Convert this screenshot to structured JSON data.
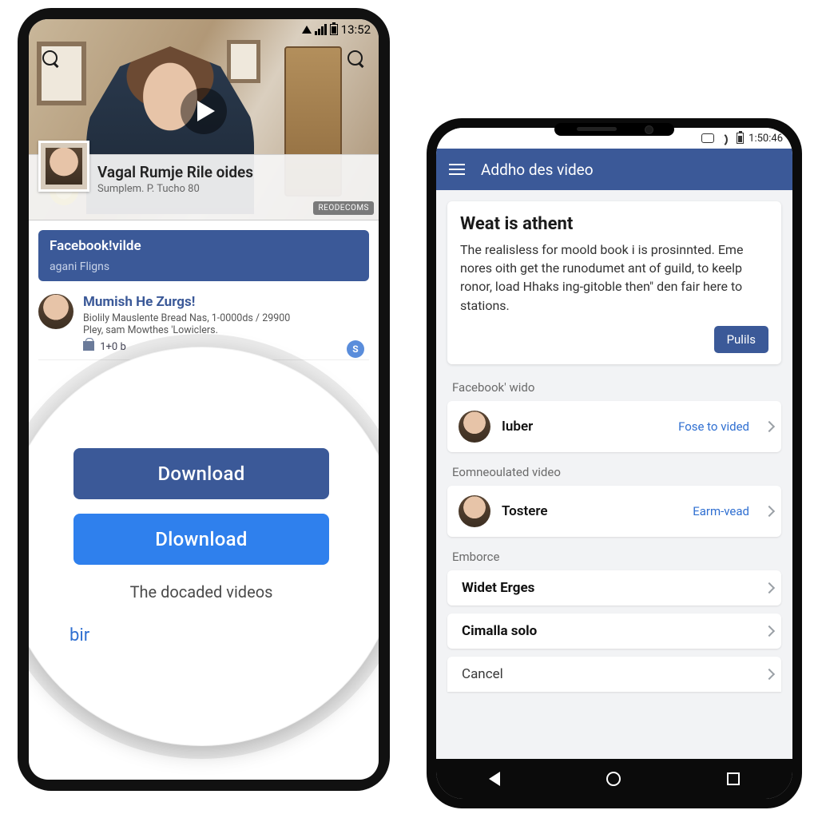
{
  "left": {
    "status_time": "13:52",
    "hero": {
      "title": "Vagal Rumje Rile oides",
      "subtitle": "Sumplem. P. Tucho 80",
      "badge": "REODECOMS"
    },
    "banner": {
      "title": "Facebook!vilde",
      "subtitle": "agani Fligns"
    },
    "post": {
      "title": "Mumish He Zurgs!",
      "line1": "Biolily Mauslente  Bread  Nas, 1-0000ds / 29900",
      "line2": "Pley, sam Mowthes 'Lowiclers.",
      "gift": "1+0 b",
      "s_badge": "S"
    },
    "lens": {
      "btn1": "Download",
      "btn2": "Dlownload",
      "caption": "The docaded videos",
      "link": "bir"
    }
  },
  "right": {
    "status_time": "1:50:46",
    "appbar_title": "Addho des video",
    "card": {
      "heading": "Weat is athent",
      "body": "The realisless for moold book i is prosinnted. Eme nores oith get the runodumet ant of guild, to keelp ronor, load Hhaks ing-gitoble then\" den fair here to stations.",
      "cta": "Pulils"
    },
    "sections": {
      "s1_label": "Facebook' wido",
      "s1_name": "Iuber",
      "s1_right": "Fose to vided",
      "s2_label": "Eomneoulated video",
      "s2_name": "Tostere",
      "s2_right": "Earm-vead",
      "s3_label": "Emborce",
      "s3_name": "Widet Erges",
      "s4_name": "Cimalla solo",
      "s5_name": "Cancel"
    }
  }
}
